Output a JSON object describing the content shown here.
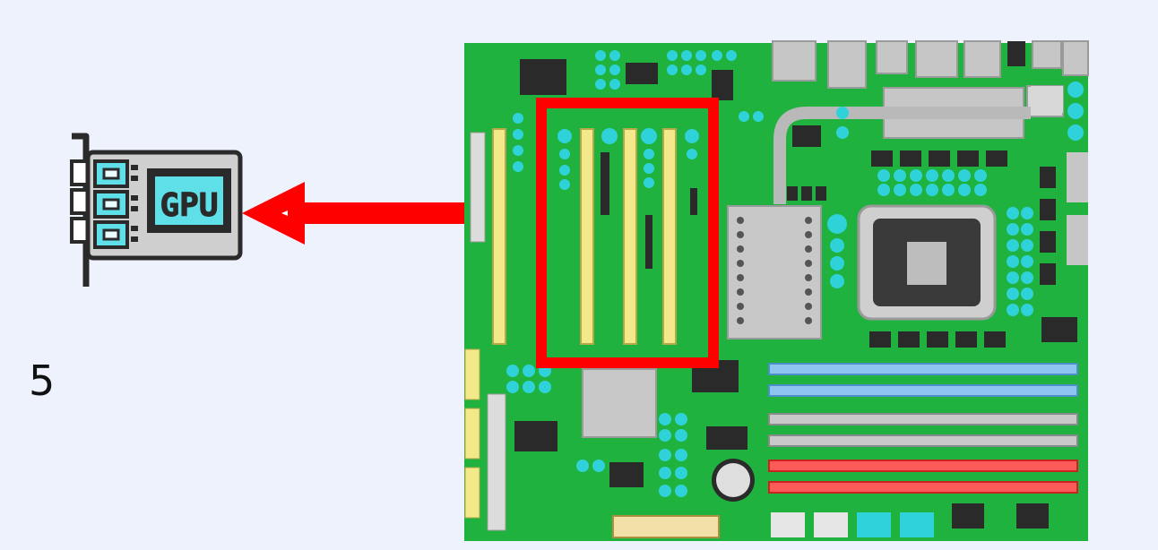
{
  "step": {
    "number": "5"
  },
  "gpu_card": {
    "label": "GPU",
    "icon": "gpu-card-icon"
  },
  "arrow": {
    "direction": "left",
    "icon": "arrow-left-icon"
  },
  "motherboard": {
    "icon": "motherboard-icon",
    "highlight": {
      "target": "pcie-slots",
      "icon": "highlight-box"
    }
  },
  "colors": {
    "background": "#eef2fd",
    "board_green": "#1fb23e",
    "highlight_red": "#ff0000",
    "slot_yellow": "#f3e98a",
    "component_cyan": "#2fd2d9",
    "ram_blue": "#8cc6f0",
    "ram_gray": "#c9c9c9",
    "ram_red": "#ff5b5b",
    "gpu_bracket": "#2a2a2a",
    "gpu_panel": "#cfcfcf"
  }
}
